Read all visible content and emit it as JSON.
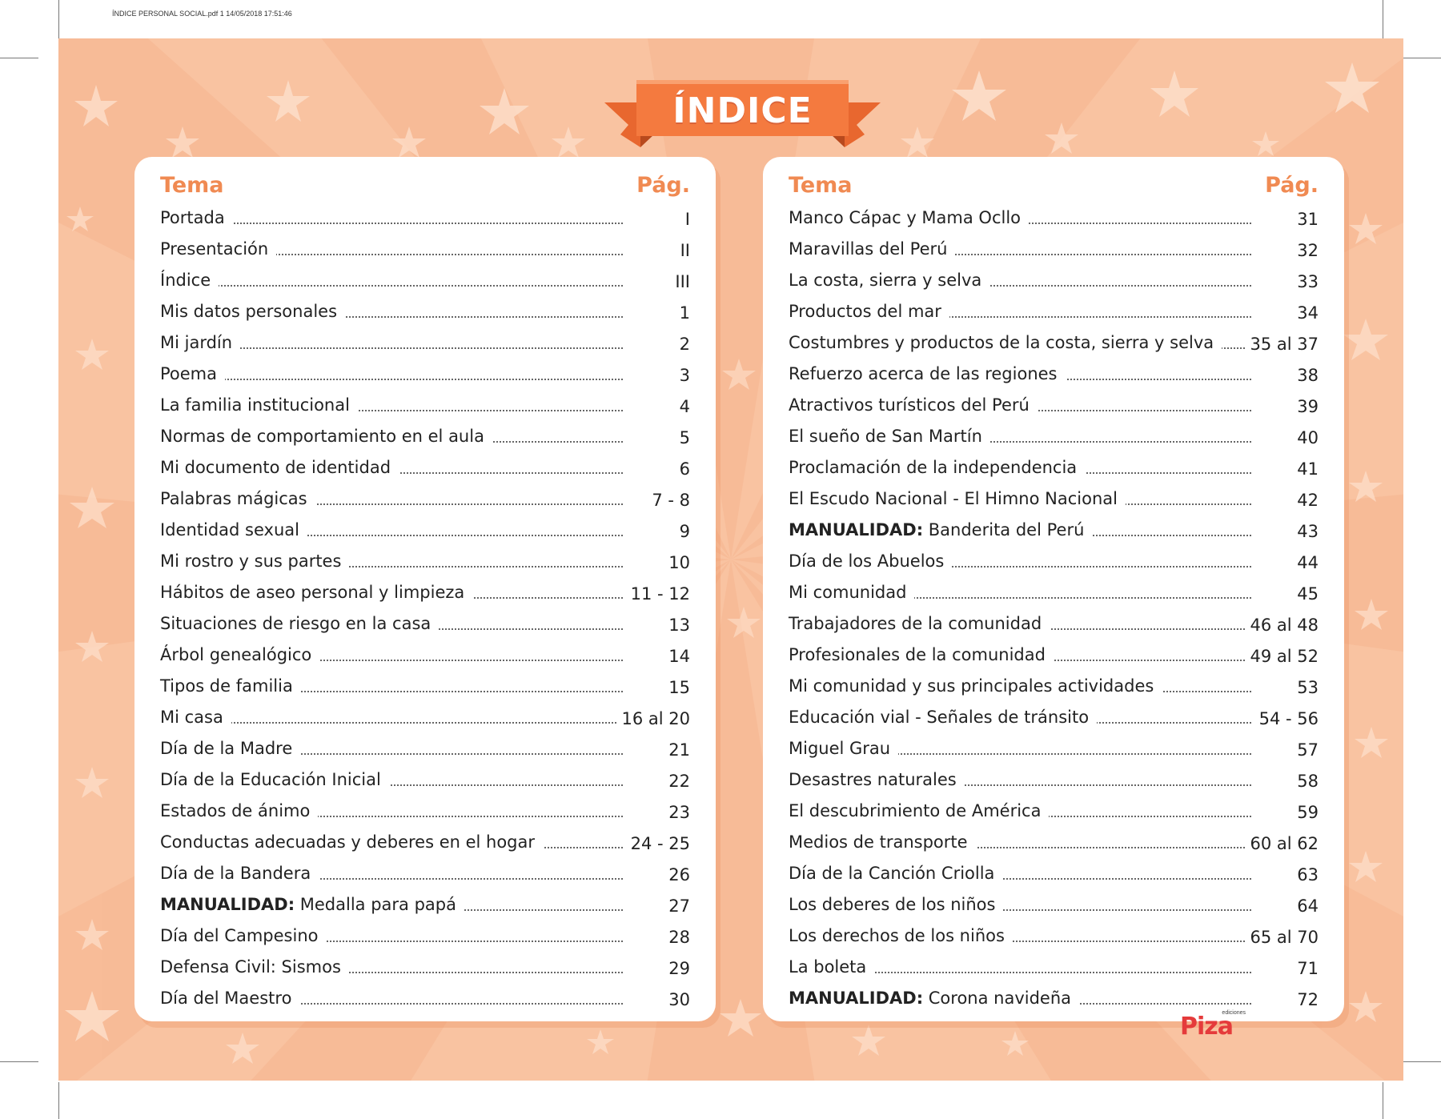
{
  "pdf_header": "ÍNDICE PERSONAL SOCIAL.pdf   1   14/05/2018   17:51:46",
  "title": "ÍNDICE",
  "brand": {
    "small": "ediciones",
    "name": "Piza"
  },
  "colors": {
    "background": "#f9c3a1",
    "accent": "#f08a52",
    "ribbon": "#f47a3f",
    "logo": "#e53b3b"
  },
  "left": {
    "header_tema": "Tema",
    "header_pag": "Pág.",
    "entries": [
      {
        "title": "Portada",
        "page": "I"
      },
      {
        "title": "Presentación",
        "page": "II"
      },
      {
        "title": "Índice",
        "page": "III"
      },
      {
        "title": "Mis datos personales",
        "page": "1"
      },
      {
        "title": "Mi jardín",
        "page": "2"
      },
      {
        "title": "Poema",
        "page": "3"
      },
      {
        "title": "La familia institucional",
        "page": "4"
      },
      {
        "title": "Normas de comportamiento en el aula",
        "page": "5"
      },
      {
        "title": "Mi documento de identidad",
        "page": "6"
      },
      {
        "title": "Palabras mágicas",
        "page": "7 - 8"
      },
      {
        "title": "Identidad sexual",
        "page": "9"
      },
      {
        "title": "Mi rostro y sus partes",
        "page": "10"
      },
      {
        "title": "Hábitos de aseo personal y limpieza",
        "page": "11 - 12"
      },
      {
        "title": "Situaciones de riesgo en la casa",
        "page": "13"
      },
      {
        "title": "Árbol genealógico",
        "page": "14"
      },
      {
        "title": "Tipos de familia",
        "page": "15"
      },
      {
        "title": "Mi casa",
        "page": "16 al 20"
      },
      {
        "title": "Día de la Madre",
        "page": "21"
      },
      {
        "title": "Día de la Educación Inicial",
        "page": "22"
      },
      {
        "title": "Estados de ánimo",
        "page": "23"
      },
      {
        "title": "Conductas adecuadas y deberes en el hogar",
        "page": "24 - 25"
      },
      {
        "title": "Día de la Bandera",
        "page": "26"
      },
      {
        "bold": "MANUALIDAD:",
        "title": " Medalla para papá",
        "page": "27"
      },
      {
        "title": "Día del Campesino",
        "page": "28"
      },
      {
        "title": "Defensa Civil: Sismos",
        "page": "29"
      },
      {
        "title": "Día del Maestro",
        "page": "30"
      }
    ]
  },
  "right": {
    "header_tema": "Tema",
    "header_pag": "Pág.",
    "entries": [
      {
        "title": "Manco Cápac y Mama Ocllo",
        "page": "31"
      },
      {
        "title": "Maravillas del Perú",
        "page": "32"
      },
      {
        "title": "La costa, sierra y selva",
        "page": "33"
      },
      {
        "title": "Productos del mar",
        "page": "34"
      },
      {
        "title": "Costumbres y productos de la costa, sierra y selva",
        "page": "35 al 37"
      },
      {
        "title": "Refuerzo acerca de las regiones",
        "page": "38"
      },
      {
        "title": "Atractivos turísticos del Perú",
        "page": "39"
      },
      {
        "title": "El sueño de San Martín",
        "page": "40"
      },
      {
        "title": "Proclamación de la independencia",
        "page": "41"
      },
      {
        "title": "El Escudo Nacional - El Himno Nacional",
        "page": "42"
      },
      {
        "bold": "MANUALIDAD:",
        "title": " Banderita del Perú",
        "page": "43"
      },
      {
        "title": "Día de los Abuelos",
        "page": "44"
      },
      {
        "title": "Mi comunidad",
        "page": "45"
      },
      {
        "title": "Trabajadores de la comunidad",
        "page": "46 al 48"
      },
      {
        "title": "Profesionales de la comunidad",
        "page": "49 al 52"
      },
      {
        "title": "Mi comunidad y sus principales actividades",
        "page": "53"
      },
      {
        "title": "Educación vial - Señales de tránsito",
        "page": "54 - 56"
      },
      {
        "title": "Miguel Grau",
        "page": "57"
      },
      {
        "title": "Desastres naturales",
        "page": "58"
      },
      {
        "title": "El descubrimiento de América",
        "page": "59"
      },
      {
        "title": "Medios de transporte",
        "page": "60 al 62"
      },
      {
        "title": "Día de la Canción Criolla",
        "page": "63"
      },
      {
        "title": "Los deberes de los niños",
        "page": "64"
      },
      {
        "title": "Los derechos de los niños",
        "page": "65 al 70"
      },
      {
        "title": "La boleta",
        "page": "71"
      },
      {
        "bold": "MANUALIDAD:",
        "title": " Corona navideña",
        "page": "72"
      }
    ]
  }
}
